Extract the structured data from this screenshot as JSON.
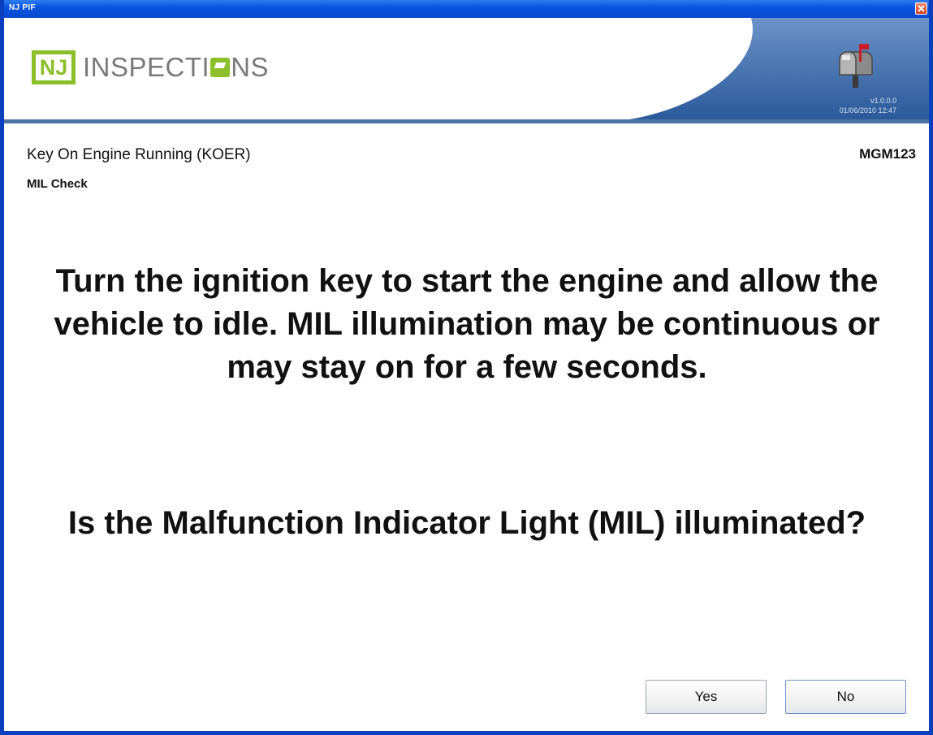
{
  "window": {
    "title": "NJ PIF"
  },
  "header": {
    "logo_abbr": "NJ",
    "logo_text_pre": "INSPECTI",
    "logo_text_post": "NS",
    "version": "v1.0.0.0",
    "datetime": "01/06/2010 12:47"
  },
  "screen": {
    "section_title": "Key On Engine Running (KOER)",
    "subsection": "MIL Check",
    "station_id": "MGM123",
    "instruction": "Turn the ignition key to start the engine and allow the vehicle to idle. MIL illumination may be continuous or may stay on for a few seconds.",
    "question": "Is the Malfunction Indicator Light (MIL) illuminated?"
  },
  "buttons": {
    "yes": "Yes",
    "no": "No"
  },
  "colors": {
    "title_bar": "#0a55e0",
    "brand_green": "#8cbf2a",
    "header_blue": "#2f5f9e"
  },
  "icons": {
    "close": "close-icon",
    "mailbox": "mailbox-icon"
  }
}
